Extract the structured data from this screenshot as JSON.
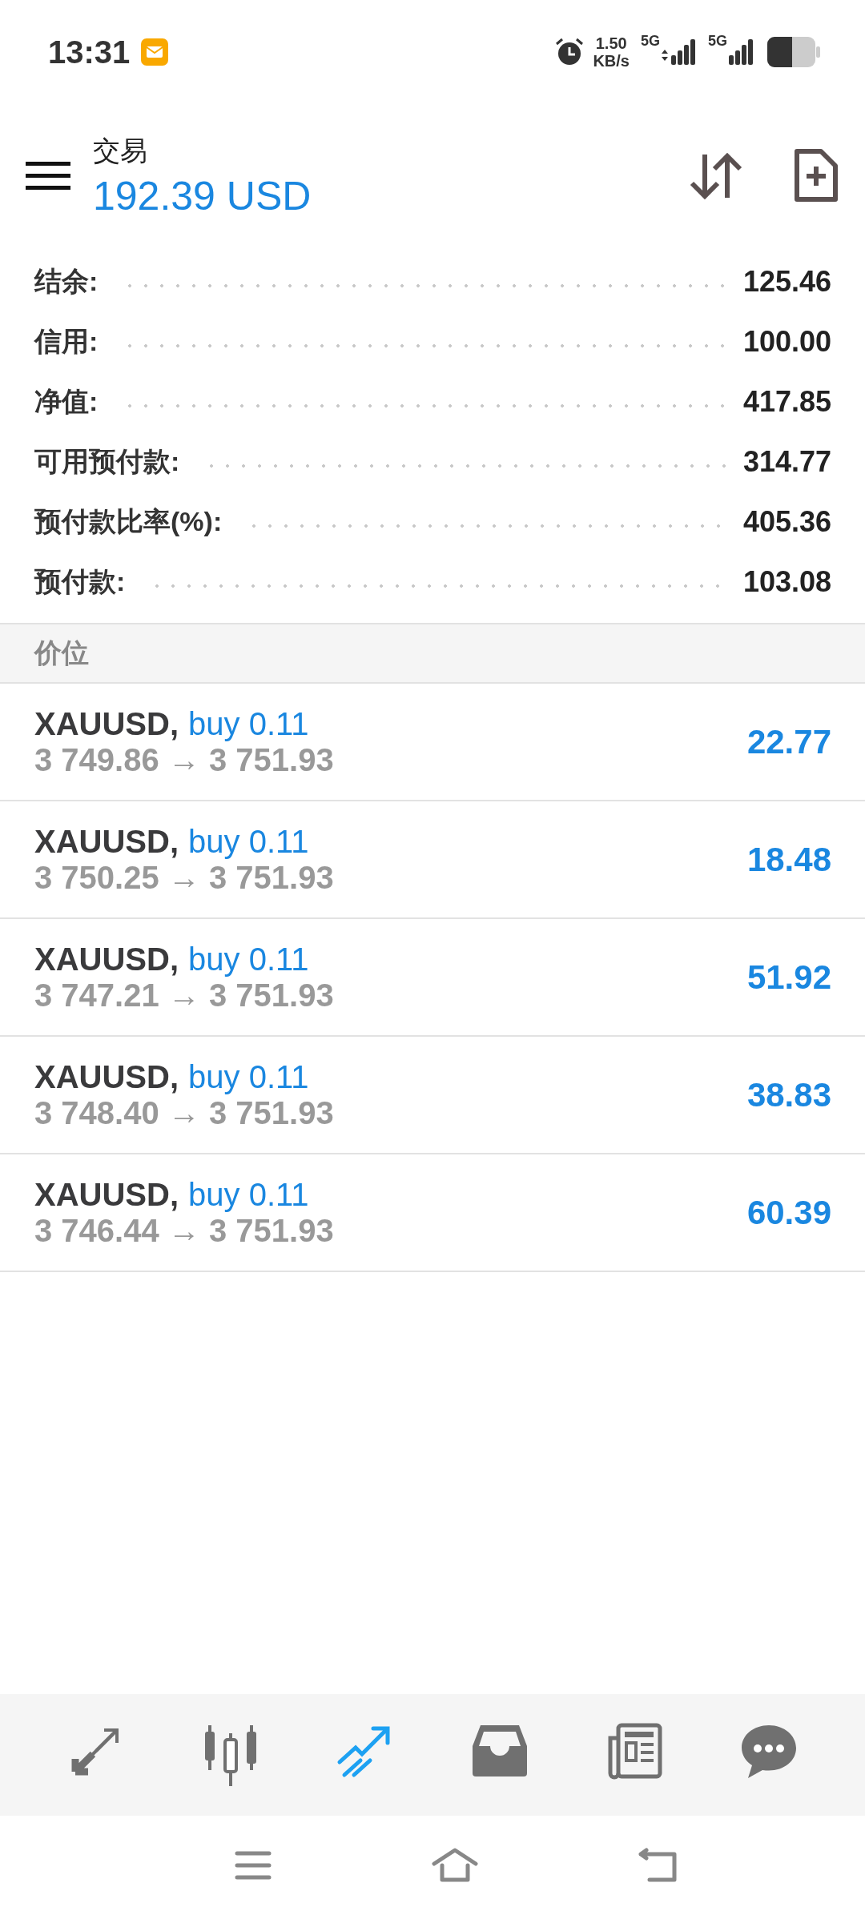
{
  "status_bar": {
    "time": "13:31",
    "speed_value": "1.50",
    "speed_unit": "KB/s",
    "sim_1": "5G",
    "sim_2": "5G"
  },
  "header": {
    "title": "交易",
    "balance": "192.39 USD"
  },
  "summary": [
    {
      "label": "结余:",
      "value": "125.46"
    },
    {
      "label": "信用:",
      "value": "100.00"
    },
    {
      "label": "净值:",
      "value": "417.85"
    },
    {
      "label": "可用预付款:",
      "value": "314.77"
    },
    {
      "label": "预付款比率(%):",
      "value": "405.36"
    },
    {
      "label": "预付款:",
      "value": "103.08"
    }
  ],
  "section_title": "价位",
  "positions": [
    {
      "symbol": "XAUUSD,",
      "order": "buy 0.11",
      "prices": "3 749.86 → 3 751.93",
      "profit": "22.77"
    },
    {
      "symbol": "XAUUSD,",
      "order": "buy 0.11",
      "prices": "3 750.25 → 3 751.93",
      "profit": "18.48"
    },
    {
      "symbol": "XAUUSD,",
      "order": "buy 0.11",
      "prices": "3 747.21 → 3 751.93",
      "profit": "51.92"
    },
    {
      "symbol": "XAUUSD,",
      "order": "buy 0.11",
      "prices": "3 748.40 → 3 751.93",
      "profit": "38.83"
    },
    {
      "symbol": "XAUUSD,",
      "order": "buy 0.11",
      "prices": "3 746.44 → 3 751.93",
      "profit": "60.39"
    }
  ],
  "bottom_nav": [
    {
      "selected": false
    },
    {
      "selected": false
    },
    {
      "selected": true
    },
    {
      "selected": false
    },
    {
      "selected": false
    },
    {
      "selected": false
    }
  ]
}
